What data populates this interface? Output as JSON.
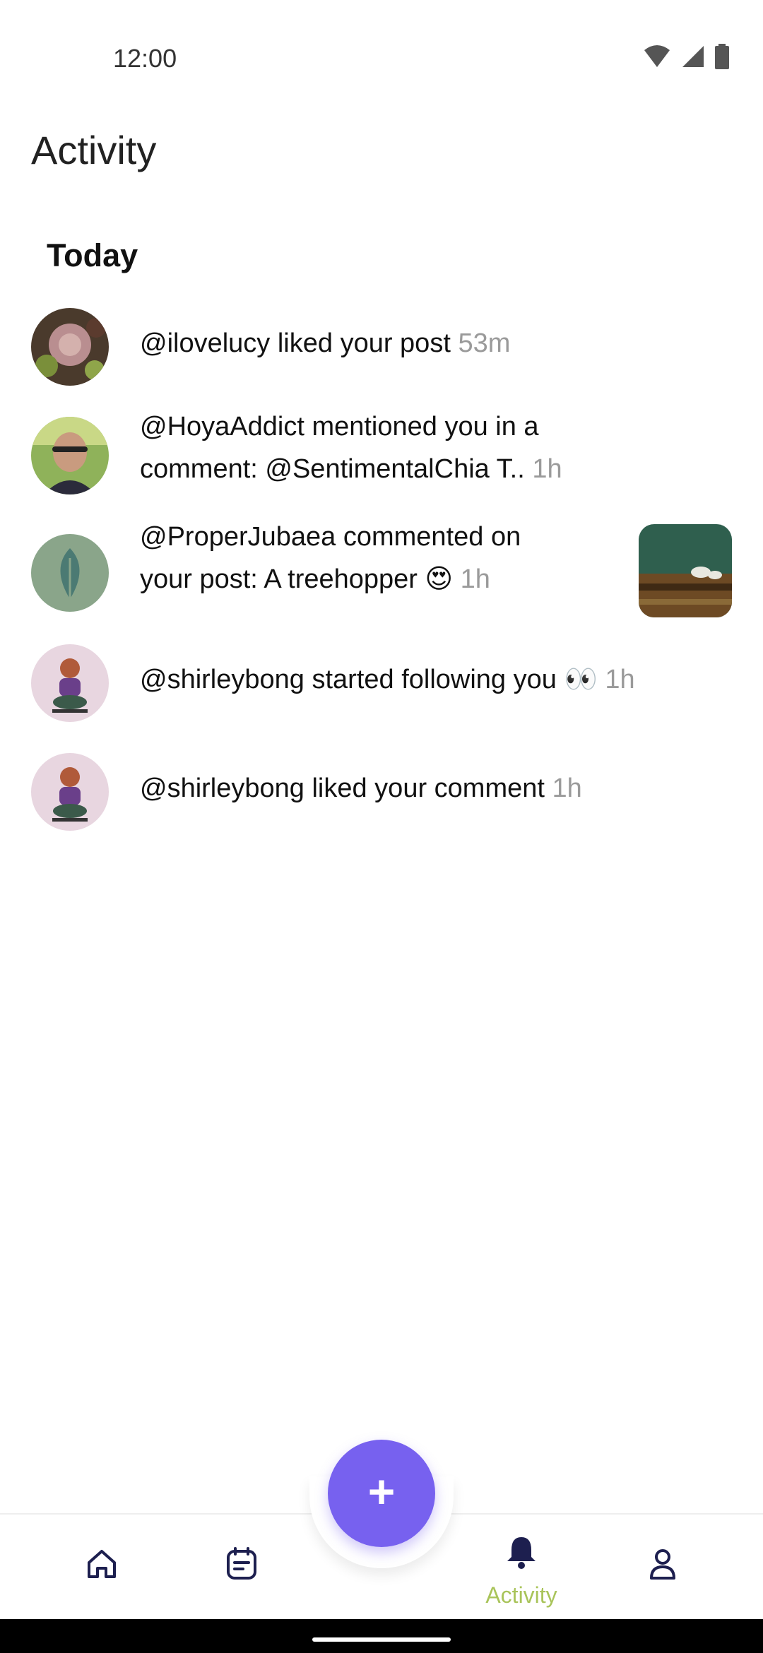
{
  "status_bar": {
    "time": "12:00",
    "icons": [
      "wifi-icon",
      "cellular-signal-icon",
      "battery-icon"
    ]
  },
  "header": {
    "title": "Activity"
  },
  "section": {
    "title": "Today"
  },
  "activities": [
    {
      "user": "@ilovelucy",
      "line1": "@ilovelucy liked your post",
      "line2": "",
      "time": "53m"
    },
    {
      "user": "@HoyaAddict",
      "line1": "@HoyaAddict mentioned you in a",
      "line2": "comment: @SentimentalChia T..",
      "time": "1h"
    },
    {
      "user": "@ProperJubaea",
      "line1": "@ProperJubaea commented on",
      "line2": "your post: A treehopper 😍",
      "time": "1h"
    },
    {
      "user": "@shirleybong",
      "line1": "@shirleybong started following you 👀",
      "line2": "",
      "time": "1h"
    },
    {
      "user": "@shirleybong",
      "line1": "@shirleybong liked your comment",
      "line2": "",
      "time": "1h"
    }
  ],
  "bottom_nav": {
    "items": [
      {
        "name": "home",
        "label": "",
        "icon": "home-icon"
      },
      {
        "name": "feed",
        "label": "",
        "icon": "feed-icon"
      },
      {
        "name": "activity",
        "label": "Activity",
        "icon": "bell-icon",
        "active": true
      },
      {
        "name": "profile",
        "label": "",
        "icon": "profile-icon"
      }
    ],
    "fab": {
      "label": "+",
      "icon": "plus-icon"
    }
  },
  "colors": {
    "accent": "#7761ef",
    "active_nav": "#a9c45a",
    "nav_icon": "#1d1f4f",
    "muted_text": "#9a9a9a"
  }
}
